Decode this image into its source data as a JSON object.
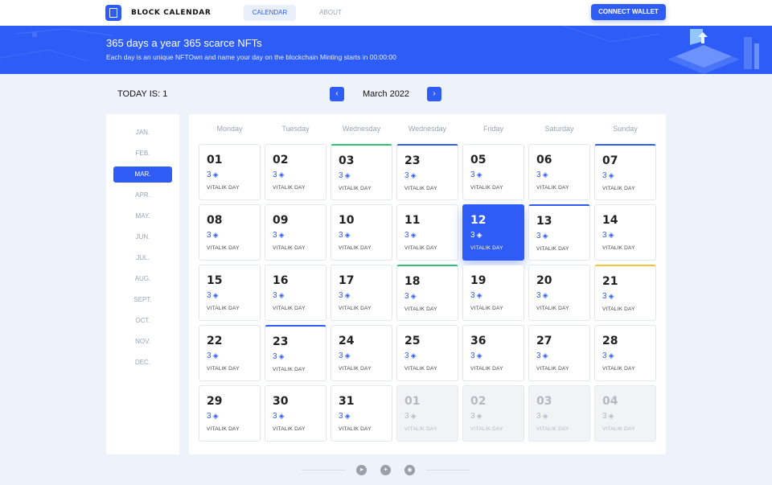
{
  "brand": {
    "name": "BLOCK CALENDAR",
    "logo_icon": "calendar-logo-icon"
  },
  "nav": {
    "tabs": [
      {
        "label": "CALENDAR",
        "active": true
      },
      {
        "label": "ABOUT",
        "active": false
      }
    ],
    "connect_label": "CONNECT WALLET"
  },
  "banner": {
    "title": "365 days a year  365 scarce NFTs",
    "subtitle": "Each day is an unique NFTOwn and name your day on the blockchain  Minting starts in 00:00:00"
  },
  "controls": {
    "today_label": "TODAY IS: 1",
    "month_label": "March 2022",
    "prev_icon": "‹",
    "next_icon": "›"
  },
  "months": [
    "JAN.",
    "FEB.",
    "MAR.",
    "APR.",
    "MAY.",
    "JUN.",
    "JUL.",
    "AUG.",
    "SEPT.",
    "OCT.",
    "NOV.",
    "DEC."
  ],
  "active_month_index": 2,
  "weekdays": [
    "Monday",
    "Tuesday",
    "Wednesday",
    "Wednesday",
    "Friday",
    "Saturday",
    "Sunday"
  ],
  "days": [
    {
      "num": "01",
      "price": "3",
      "label": "VITALIK DAY",
      "accent": "",
      "state": ""
    },
    {
      "num": "02",
      "price": "3",
      "label": "VITALIK DAY",
      "accent": "",
      "state": ""
    },
    {
      "num": "03",
      "price": "3",
      "label": "VITALIK DAY",
      "accent": "green",
      "state": ""
    },
    {
      "num": "23",
      "price": "3",
      "label": "VITALIK DAY",
      "accent": "blue",
      "state": ""
    },
    {
      "num": "05",
      "price": "3",
      "label": "VITALIK DAY",
      "accent": "",
      "state": ""
    },
    {
      "num": "06",
      "price": "3",
      "label": "VITALIK DAY",
      "accent": "",
      "state": ""
    },
    {
      "num": "07",
      "price": "3",
      "label": "VITALIK DAY",
      "accent": "blue",
      "state": ""
    },
    {
      "num": "08",
      "price": "3",
      "label": "VITALIK DAY",
      "accent": "",
      "state": ""
    },
    {
      "num": "09",
      "price": "3",
      "label": "VITALIK DAY",
      "accent": "",
      "state": ""
    },
    {
      "num": "10",
      "price": "3",
      "label": "VITALIK DAY",
      "accent": "",
      "state": ""
    },
    {
      "num": "11",
      "price": "3",
      "label": "VITALIK DAY",
      "accent": "",
      "state": ""
    },
    {
      "num": "12",
      "price": "3",
      "label": "VITALIK DAY",
      "accent": "",
      "state": "selected"
    },
    {
      "num": "13",
      "price": "3",
      "label": "VITALIK DAY",
      "accent": "blue",
      "state": ""
    },
    {
      "num": "14",
      "price": "3",
      "label": "VITALIK DAY",
      "accent": "",
      "state": ""
    },
    {
      "num": "15",
      "price": "3",
      "label": "VITALIK DAY",
      "accent": "",
      "state": ""
    },
    {
      "num": "16",
      "price": "3",
      "label": "VITALIK DAY",
      "accent": "",
      "state": ""
    },
    {
      "num": "17",
      "price": "3",
      "label": "VITALIK DAY",
      "accent": "",
      "state": ""
    },
    {
      "num": "18",
      "price": "3",
      "label": "VITALIK DAY",
      "accent": "green",
      "state": ""
    },
    {
      "num": "19",
      "price": "3",
      "label": "VITALIK DAY",
      "accent": "",
      "state": ""
    },
    {
      "num": "20",
      "price": "3",
      "label": "VITALIK DAY",
      "accent": "",
      "state": ""
    },
    {
      "num": "21",
      "price": "3",
      "label": "VITALIK DAY",
      "accent": "yellow",
      "state": ""
    },
    {
      "num": "22",
      "price": "3",
      "label": "VITALIK DAY",
      "accent": "",
      "state": ""
    },
    {
      "num": "23",
      "price": "3",
      "label": "VITALIK DAY",
      "accent": "blue",
      "state": ""
    },
    {
      "num": "24",
      "price": "3",
      "label": "VITALIK DAY",
      "accent": "",
      "state": ""
    },
    {
      "num": "25",
      "price": "3",
      "label": "VITALIK DAY",
      "accent": "",
      "state": ""
    },
    {
      "num": "36",
      "price": "3",
      "label": "VITALIK DAY",
      "accent": "",
      "state": ""
    },
    {
      "num": "27",
      "price": "3",
      "label": "VITALIK DAY",
      "accent": "",
      "state": ""
    },
    {
      "num": "28",
      "price": "3",
      "label": "VITALIK DAY",
      "accent": "",
      "state": ""
    },
    {
      "num": "29",
      "price": "3",
      "label": "VITALIK DAY",
      "accent": "",
      "state": ""
    },
    {
      "num": "30",
      "price": "3",
      "label": "VITALIK DAY",
      "accent": "",
      "state": ""
    },
    {
      "num": "31",
      "price": "3",
      "label": "VITALIK DAY",
      "accent": "",
      "state": ""
    },
    {
      "num": "01",
      "price": "3",
      "label": "VITALIK DAY",
      "accent": "",
      "state": "disabled"
    },
    {
      "num": "02",
      "price": "3",
      "label": "VITALIK DAY",
      "accent": "",
      "state": "disabled"
    },
    {
      "num": "03",
      "price": "3",
      "label": "VITALIK DAY",
      "accent": "",
      "state": "disabled"
    },
    {
      "num": "04",
      "price": "3",
      "label": "VITALIK DAY",
      "accent": "",
      "state": "disabled"
    }
  ],
  "footer": {
    "social_icons": [
      "telegram-icon",
      "twitter-icon",
      "discord-icon"
    ]
  },
  "colors": {
    "accent": "#2f5cf5",
    "green": "#2ec277",
    "yellow": "#f5c33b",
    "background": "#eef2fb"
  }
}
